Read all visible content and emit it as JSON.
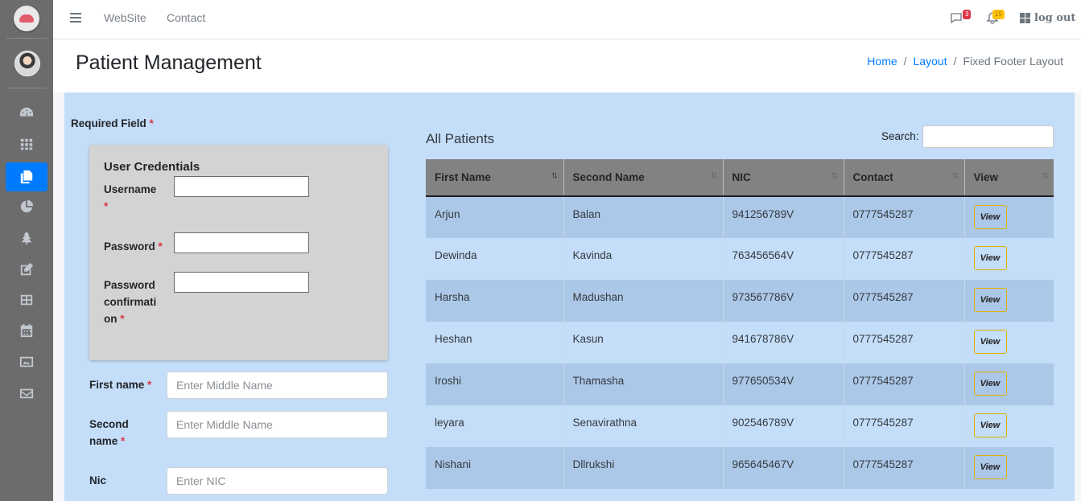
{
  "topbar": {
    "nav": [
      "WebSite",
      "Contact"
    ],
    "messages_badge": "3",
    "notifications_badge": "15",
    "logout_label": "log out"
  },
  "header": {
    "title": "Patient Management",
    "breadcrumb": [
      "Home",
      "Layout",
      "Fixed Footer Layout"
    ],
    "separator": "/"
  },
  "form": {
    "required_label": "Required Field",
    "star": "*",
    "credentials_title": "User Credentials",
    "username_label": "Username",
    "password_label": "Password",
    "password_confirm_label_1": "Password",
    "password_confirm_label_2": "confirmati",
    "password_confirm_label_3": "on",
    "first_name_label": "First name",
    "first_name_placeholder": "Enter Middle Name",
    "second_name_label_1": "Second",
    "second_name_label_2": "name",
    "second_name_placeholder": "Enter Middle Name",
    "nic_label": "Nic",
    "nic_placeholder": "Enter NIC"
  },
  "table": {
    "title": "All Patients",
    "search_label": "Search:",
    "columns": [
      "First Name",
      "Second Name",
      "NIC",
      "Contact",
      "View"
    ],
    "view_label": "View",
    "rows": [
      [
        "Arjun",
        "Balan",
        "941256789V",
        "0777545287"
      ],
      [
        "Dewinda",
        "Kavinda",
        "763456564V",
        "0777545287"
      ],
      [
        "Harsha",
        "Madushan",
        "973567786V",
        "0777545287"
      ],
      [
        "Heshan",
        "Kasun",
        "941678786V",
        "0777545287"
      ],
      [
        "Iroshi",
        "Thamasha",
        "977650534V",
        "0777545287"
      ],
      [
        "leyara",
        "Senavirathna",
        "902546789V",
        "0777545287"
      ],
      [
        "Nishani",
        "Dllrukshi",
        "965645467V",
        "0777545287"
      ]
    ]
  },
  "colors": {
    "sidebar": "#6c6c6c",
    "accent": "#007bff",
    "main_bg": "#c4ddf8",
    "table_header": "#828282",
    "view_border": "#e0b100"
  },
  "sidebar_icons": [
    "dashboard-icon",
    "apps-grid-icon",
    "copy-icon",
    "pie-chart-icon",
    "tree-icon",
    "edit-icon",
    "table-icon",
    "calendar-icon",
    "image-icon",
    "envelope-icon"
  ]
}
